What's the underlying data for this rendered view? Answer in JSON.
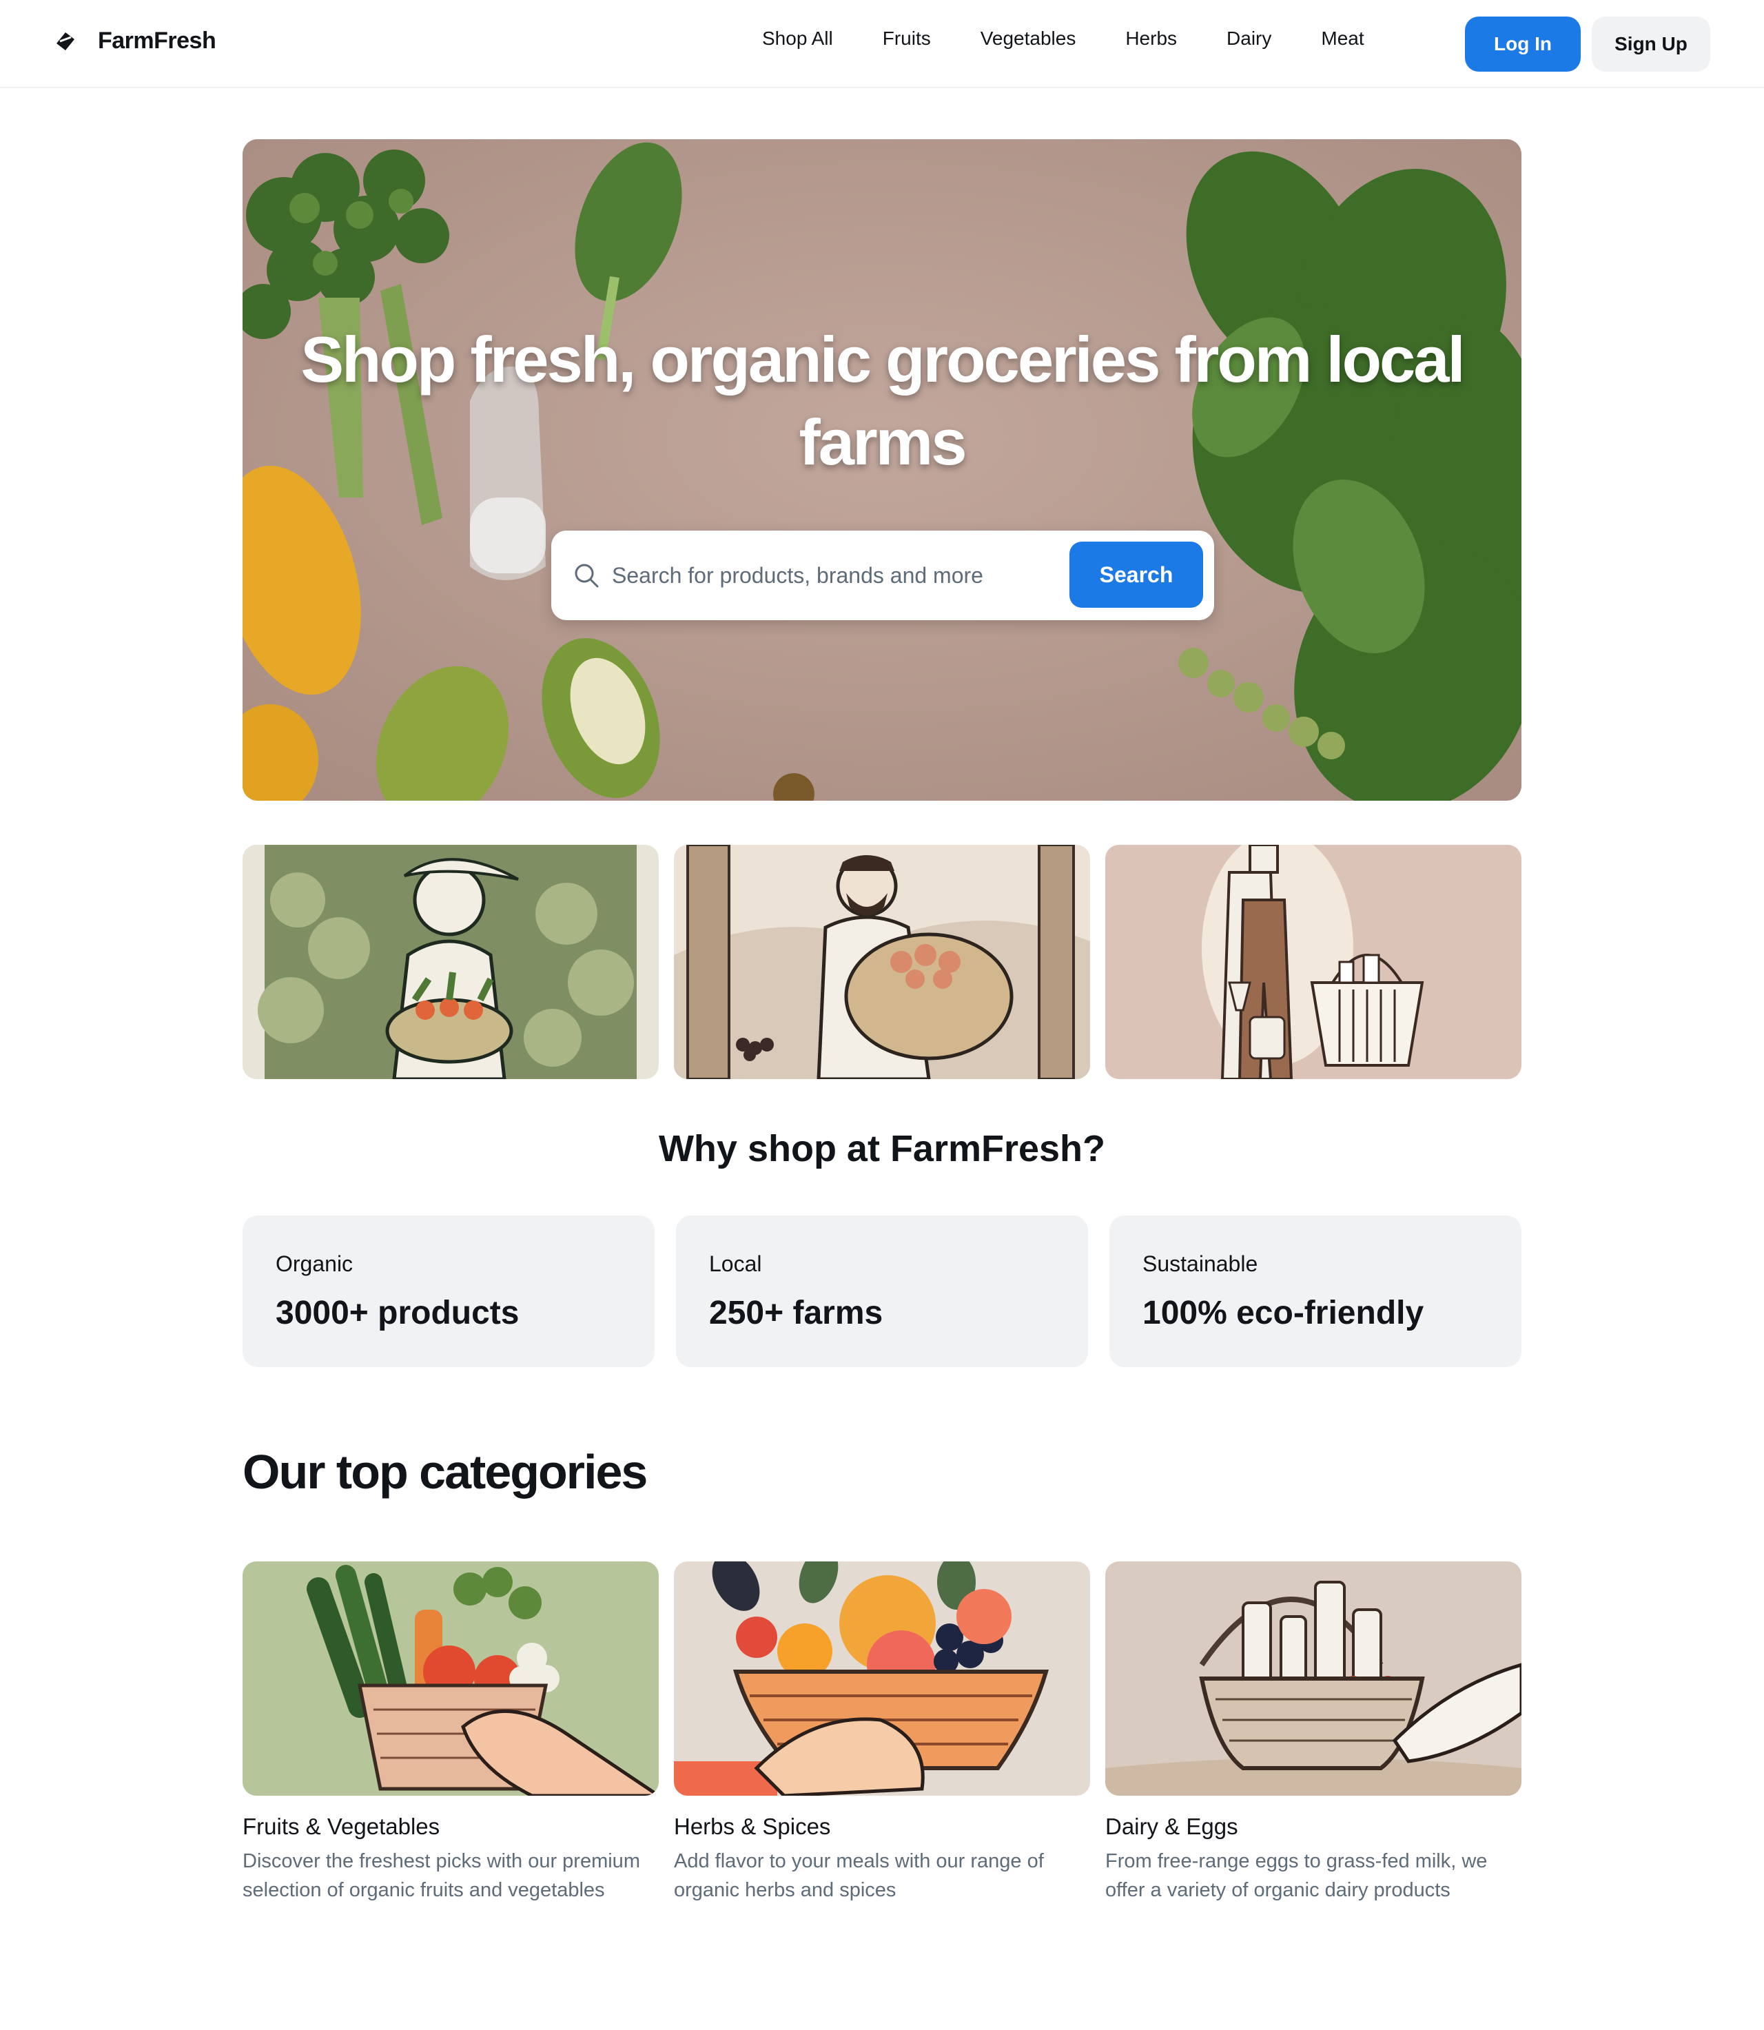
{
  "app": {
    "brand": "FarmFresh",
    "accent_color": "#1b7ae6"
  },
  "nav": {
    "items": [
      "Shop All",
      "Fruits",
      "Vegetables",
      "Herbs",
      "Dairy",
      "Meat"
    ],
    "login_label": "Log In",
    "signup_label": "Sign Up"
  },
  "hero": {
    "title": "Shop fresh, organic groceries from local farms",
    "search": {
      "placeholder": "Search for products, brands and more",
      "button_label": "Search",
      "icon": "search-icon"
    }
  },
  "why": {
    "title": "Why shop at FarmFresh?",
    "stats": [
      {
        "label": "Organic",
        "value": "3000+ products"
      },
      {
        "label": "Local",
        "value": "250+ farms"
      },
      {
        "label": "Sustainable",
        "value": "100% eco-friendly"
      }
    ]
  },
  "categories": {
    "title": "Our top categories",
    "items": [
      {
        "name": "Fruits & Vegetables",
        "description": "Discover the freshest picks with our premium selection of organic fruits and vegetables"
      },
      {
        "name": "Herbs & Spices",
        "description": "Add flavor to your meals with our range of organic herbs and spices"
      },
      {
        "name": "Dairy & Eggs",
        "description": "From free-range eggs to grass-fed milk, we offer a variety of organic dairy products"
      }
    ]
  }
}
